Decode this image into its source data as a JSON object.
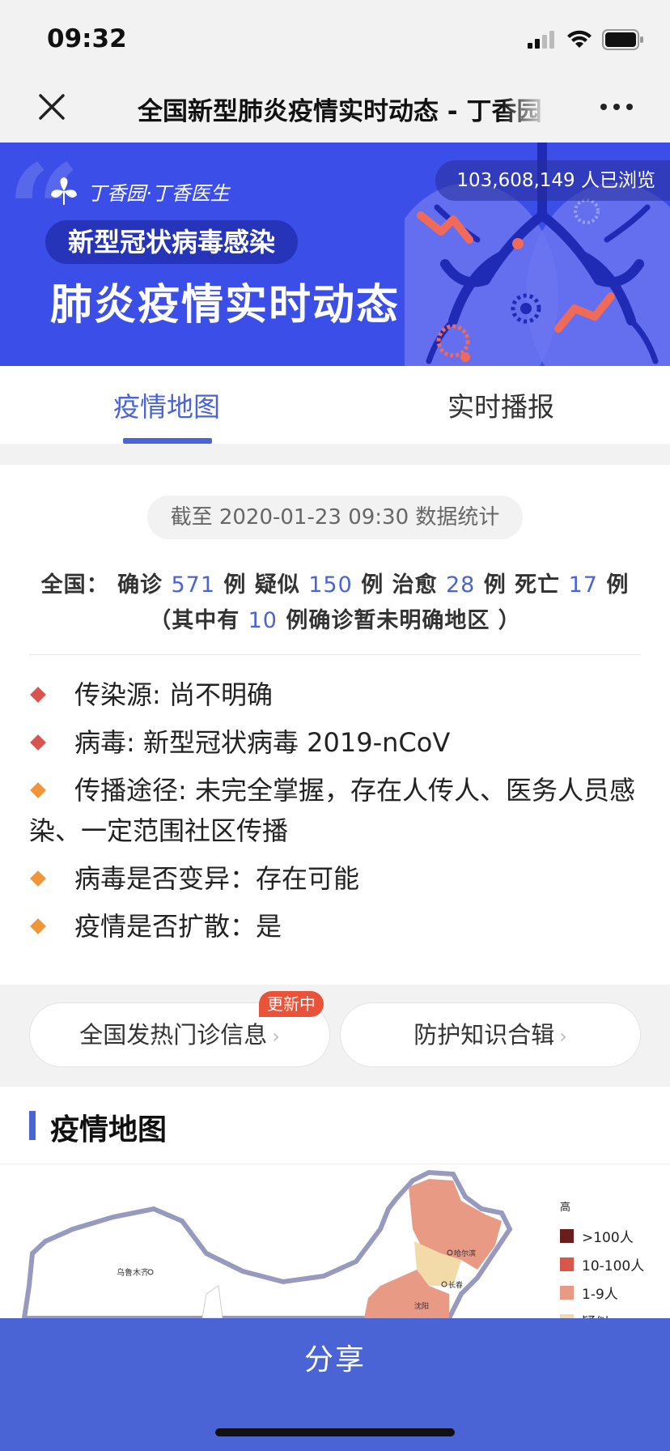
{
  "status_bar": {
    "time": "09:32"
  },
  "nav": {
    "title": "全国新型肺炎疫情实时动态 - 丁香园"
  },
  "banner": {
    "views": "103,608,149 人已浏览",
    "brand": "丁香园·丁香医生",
    "pill": "新型冠状病毒感染",
    "main": "肺炎疫情实时动态",
    "quote_glyph": "“"
  },
  "tabs": [
    {
      "label": "疫情地图",
      "active": true
    },
    {
      "label": "实时播报",
      "active": false
    }
  ],
  "stats": {
    "date": "截至 2020-01-23 09:30 数据统计",
    "prefix": "全国：",
    "confirmed_label": "确诊",
    "confirmed": "571",
    "suspected_label": "疑似",
    "suspected": "150",
    "cured_label": "治愈",
    "cured": "28",
    "dead_label": "死亡",
    "dead": "17",
    "unit": "例",
    "unclear_prefix": "（其中有",
    "unclear": "10",
    "unclear_suffix": "例确诊暂未明确地区 ）"
  },
  "facts": [
    {
      "text": "传染源: 尚不明确",
      "color": "#d9534f"
    },
    {
      "text": "病毒: 新型冠状病毒 2019-nCoV",
      "color": "#d9534f"
    },
    {
      "text": "传播途径: 未完全掌握，存在人传人、医务人员感染、一定范围社区传播",
      "color": "#f0953a"
    },
    {
      "text": "病毒是否变异：存在可能",
      "color": "#f0953a"
    },
    {
      "text": "疫情是否扩散：是",
      "color": "#f0953a"
    }
  ],
  "links": {
    "fever_clinics": "全国发热门诊信息",
    "fever_badge": "更新中",
    "protection": "防护知识合辑",
    "chevron": "›"
  },
  "section": {
    "title": "疫情地图"
  },
  "map": {
    "cities": [
      "乌鲁木齐",
      "哈尔滨",
      "长春",
      "沈阳"
    ],
    "legend_title": "高",
    "legend": [
      {
        "label": ">100人",
        "color": "#6b1d1d"
      },
      {
        "label": "10-100人",
        "color": "#d9574a"
      },
      {
        "label": "1-9人",
        "color": "#e89a85"
      },
      {
        "label": "疑似",
        "color": "#f2dba8"
      }
    ]
  },
  "share": {
    "label": "分享"
  },
  "colors": {
    "accent": "#4a64d6",
    "banner": "#3b4ee8",
    "badge": "#e8533a"
  }
}
